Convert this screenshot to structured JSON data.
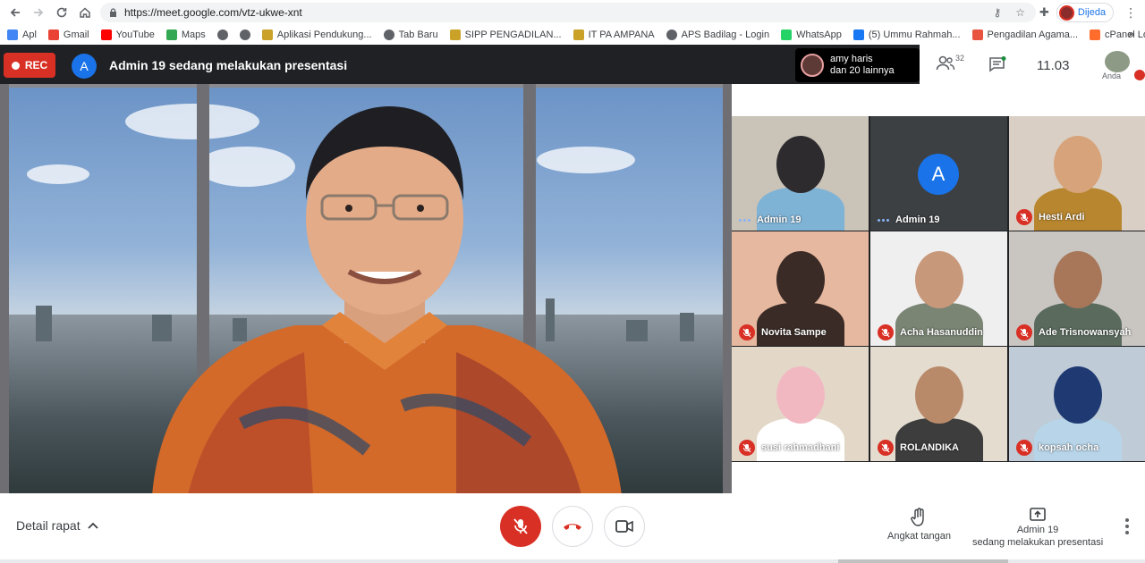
{
  "browser": {
    "url": "https://meet.google.com/vtz-ukwe-xnt",
    "profile_name": "Dijeda",
    "bookmarks": [
      {
        "label": "Apl",
        "icon": "apps-grid-icon",
        "color": "#4285f4"
      },
      {
        "label": "Gmail",
        "icon": "gmail-icon",
        "color": "#ea4335"
      },
      {
        "label": "YouTube",
        "icon": "youtube-icon",
        "color": "#ff0000"
      },
      {
        "label": "Maps",
        "icon": "maps-icon",
        "color": "#34a853"
      },
      {
        "label": "",
        "icon": "globe-icon",
        "color": "#5f6368"
      },
      {
        "label": "",
        "icon": "globe-icon",
        "color": "#5f6368"
      },
      {
        "label": "Aplikasi Pendukung...",
        "icon": "emblem-icon",
        "color": "#c9a227"
      },
      {
        "label": "Tab Baru",
        "icon": "globe-icon",
        "color": "#5f6368"
      },
      {
        "label": "SIPP PENGADILAN...",
        "icon": "emblem-icon",
        "color": "#c9a227"
      },
      {
        "label": "IT PA AMPANA",
        "icon": "emblem-icon",
        "color": "#c9a227"
      },
      {
        "label": "APS Badilag - Login",
        "icon": "globe-icon",
        "color": "#5f6368"
      },
      {
        "label": "WhatsApp",
        "icon": "whatsapp-icon",
        "color": "#25d366"
      },
      {
        "label": "(5) Ummu Rahmah...",
        "icon": "facebook-icon",
        "color": "#1877f2"
      },
      {
        "label": "Pengadilan Agama...",
        "icon": "joomla-icon",
        "color": "#e8543f"
      },
      {
        "label": "cPanel Login",
        "icon": "cpanel-icon",
        "color": "#ff6c2c"
      }
    ],
    "bookmarks_more": "»"
  },
  "meet": {
    "rec_label": "REC",
    "presenter_initial": "A",
    "presenter_title": "Admin 19 sedang melakukan presentasi",
    "people_card": {
      "line1": "amy haris",
      "line2": "dan 20 lainnya"
    },
    "participant_count": "32",
    "clock": "11.03",
    "self_label": "Anda",
    "tiles": [
      {
        "name": "Admin 19",
        "state": "speaking",
        "kind": "video",
        "bg": "#c9c3b8",
        "skin": "#2d2b2e",
        "mask": "#7fb3d6"
      },
      {
        "name": "Admin 19",
        "state": "speaking",
        "kind": "avatar",
        "initial": "A",
        "bg": "#3c4043"
      },
      {
        "name": "Hesti Ardi",
        "state": "muted",
        "kind": "video",
        "bg": "#d9cfc4",
        "skin": "#d7a37a",
        "mask": "#b8862e"
      },
      {
        "name": "Novita Sampe",
        "state": "muted",
        "kind": "video",
        "bg": "#e6b8a0",
        "skin": "#3a2b26",
        "mask": "#3a2b26"
      },
      {
        "name": "Acha Hasanuddin",
        "state": "muted",
        "kind": "video",
        "bg": "#efefef",
        "skin": "#c8987a",
        "mask": "#7a8574"
      },
      {
        "name": "Ade Trisnowansyah",
        "state": "muted",
        "kind": "video",
        "bg": "#c9c6c2",
        "skin": "#a87659",
        "mask": "#5a6b5e"
      },
      {
        "name": "susi rahmadhani",
        "state": "muted",
        "kind": "video",
        "bg": "#e3d8c8",
        "skin": "#f1b8c2",
        "mask": "#ffffff"
      },
      {
        "name": "ROLANDIKA",
        "state": "muted",
        "kind": "video",
        "bg": "#e4dccf",
        "skin": "#b98a6a",
        "mask": "#3d3d3d"
      },
      {
        "name": "kopsah ocha",
        "state": "muted",
        "kind": "video",
        "bg": "#bfcbd6",
        "skin": "#1f3a72",
        "mask": "#b7d4e8"
      }
    ]
  },
  "bottom": {
    "details_label": "Detail rapat",
    "raise_hand_label": "Angkat tangan",
    "presenting_line1": "Admin 19",
    "presenting_line2": "sedang melakukan presentasi"
  }
}
